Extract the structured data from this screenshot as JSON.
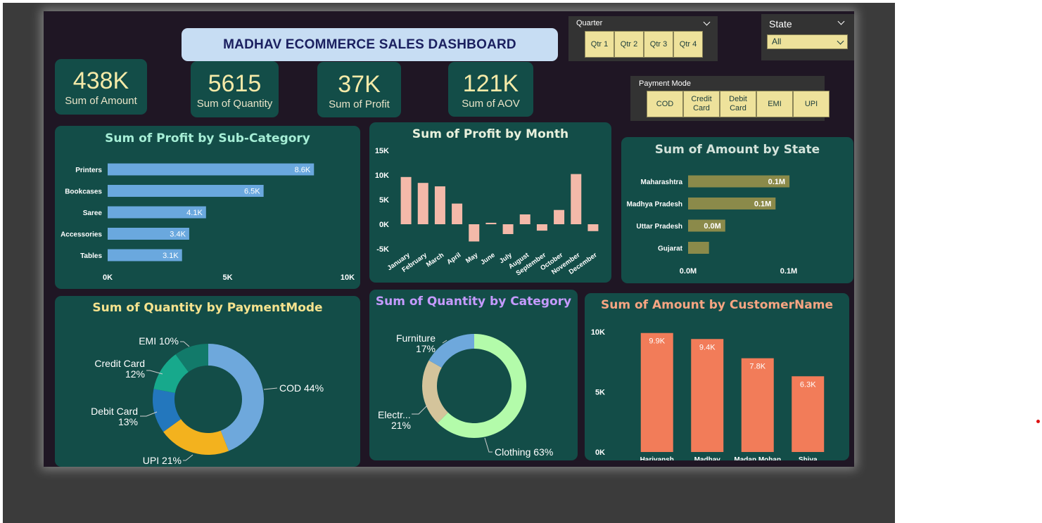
{
  "dashboard": {
    "title": "MADHAV ECOMMERCE SALES DASHBOARD"
  },
  "kpis": [
    {
      "value": "438K",
      "label": "Sum of Amount"
    },
    {
      "value": "5615",
      "label": "Sum of Quantity"
    },
    {
      "value": "37K",
      "label": "Sum of Profit"
    },
    {
      "value": "121K",
      "label": "Sum of AOV"
    }
  ],
  "filters": {
    "quarter": {
      "title": "Quarter",
      "options": [
        "Qtr 1",
        "Qtr 2",
        "Qtr 3",
        "Qtr 4"
      ]
    },
    "state": {
      "title": "State",
      "selected": "All"
    },
    "payment_mode": {
      "title": "Payment Mode",
      "options": [
        "COD",
        "Credit Card",
        "Debit Card",
        "EMI",
        "UPI"
      ]
    }
  },
  "colors": {
    "card_bg": "#134d48",
    "canvas_bg": "#1f1624",
    "profit_subcat_bar": "#6aa8de",
    "profit_month_bar": "#f4b9a9",
    "state_bar": "#8b8a4a",
    "customer_bar": "#f27c59",
    "title_subcat": "#a6eed6",
    "title_month": "#e8f0dc",
    "title_state": "#d4e3db",
    "title_payment": "#f6e38e",
    "title_category": "#c59bff",
    "title_customer": "#f7a582"
  },
  "chart_data": [
    {
      "id": "profit_by_subcategory",
      "type": "bar",
      "orientation": "horizontal",
      "title": "Sum of Profit by Sub-Category",
      "categories": [
        "Printers",
        "Bookcases",
        "Saree",
        "Accessories",
        "Tables"
      ],
      "values": [
        8600,
        6500,
        4100,
        3400,
        3100
      ],
      "data_labels": [
        "8.6K",
        "6.5K",
        "4.1K",
        "3.4K",
        "3.1K"
      ],
      "xlim": [
        0,
        10000
      ],
      "x_ticks": [
        "0K",
        "5K",
        "10K"
      ]
    },
    {
      "id": "profit_by_month",
      "type": "bar",
      "title": "Sum of Profit by Month",
      "categories": [
        "January",
        "February",
        "March",
        "April",
        "May",
        "June",
        "July",
        "August",
        "September",
        "October",
        "November",
        "December"
      ],
      "values": [
        9600,
        8400,
        7700,
        4200,
        -3500,
        300,
        -2000,
        2000,
        -1300,
        2900,
        10200,
        -1400
      ],
      "ylim": [
        -5000,
        15000
      ],
      "y_ticks": [
        "-5K",
        "0K",
        "5K",
        "10K",
        "15K"
      ]
    },
    {
      "id": "amount_by_state",
      "type": "bar",
      "orientation": "horizontal",
      "title": "Sum of Amount by State",
      "categories": [
        "Maharashtra",
        "Madhya Pradesh",
        "Uttar Pradesh",
        "Gujarat"
      ],
      "values": [
        131000,
        113000,
        48000,
        27000
      ],
      "data_labels": [
        "0.1M",
        "0.1M",
        "0.0M",
        ""
      ],
      "xlim": [
        0,
        130000
      ],
      "x_ticks": [
        "0.0M",
        "0.1M"
      ]
    },
    {
      "id": "quantity_by_paymentmode",
      "type": "pie",
      "donut": true,
      "title": "Sum of Quantity by PaymentMode",
      "categories": [
        "COD",
        "UPI",
        "Debit Card",
        "Credit Card",
        "EMI"
      ],
      "values": [
        44,
        21,
        13,
        12,
        10
      ],
      "labels": [
        {
          "name": "COD",
          "pct": "44%"
        },
        {
          "name": "UPI",
          "pct": "21%"
        },
        {
          "name": "Debit Card",
          "pct": "13%"
        },
        {
          "name": "Credit Card",
          "pct": "12%"
        },
        {
          "name": "EMI",
          "pct": "10%"
        }
      ],
      "colors": [
        "#6ea8dc",
        "#f3b21e",
        "#2377bd",
        "#17a98c",
        "#127a6a"
      ]
    },
    {
      "id": "quantity_by_category",
      "type": "pie",
      "donut": true,
      "title": "Sum of Quantity by Category",
      "categories": [
        "Clothing",
        "Electronics",
        "Furniture"
      ],
      "values": [
        63,
        21,
        17
      ],
      "labels": [
        {
          "name": "Clothing",
          "pct": "63%"
        },
        {
          "name": "Electr...",
          "pct": "21%"
        },
        {
          "name": "Furniture",
          "pct": "17%"
        }
      ],
      "colors": [
        "#b3fbaa",
        "#d4c49b",
        "#6ea8dc"
      ]
    },
    {
      "id": "amount_by_customername",
      "type": "bar",
      "title": "Sum of Amount by CustomerName",
      "categories": [
        "Harivansh",
        "Madhav",
        "Madan Mohan",
        "Shiva"
      ],
      "values": [
        9900,
        9400,
        7800,
        6300
      ],
      "data_labels": [
        "9.9K",
        "9.4K",
        "7.8K",
        "6.3K"
      ],
      "ylim": [
        0,
        10000
      ],
      "y_ticks": [
        "0K",
        "5K",
        "10K"
      ]
    }
  ]
}
